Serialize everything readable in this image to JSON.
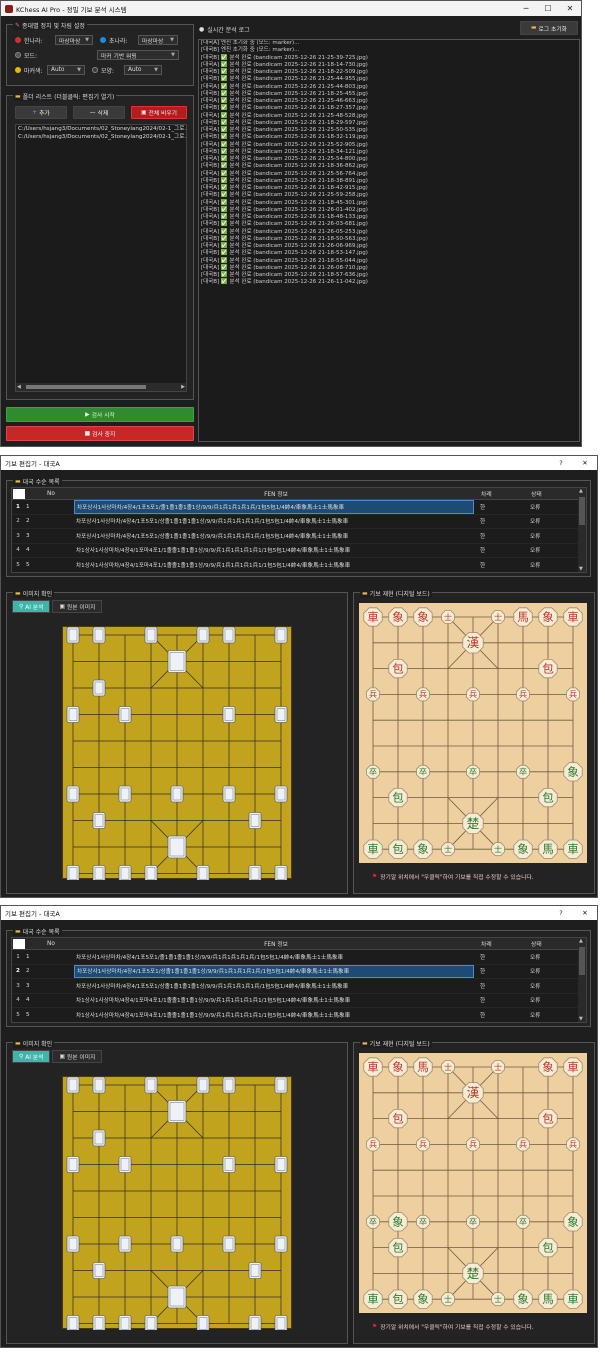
{
  "main_window": {
    "title": "KChess AI Pro - 정밀 기보 분석 시스템",
    "settings_group": "종대별 정치 및 차림 설정",
    "han_label": "한나라:",
    "han_value": "마상마상",
    "cho_label": "초나라:",
    "cho_value": "마상마상",
    "mode_label": "모드:",
    "mode_value": "마커 기반 워핑",
    "marker_label": "마커색:",
    "marker_value": "Auto",
    "shape_label": "모양:",
    "shape_value": "Auto",
    "folder_group": "폴더 리스트 (더블클릭: 편집기 열기)",
    "add_btn": "추가",
    "delete_btn": "삭제",
    "clear_btn": "전체 비우기",
    "folders": [
      "C:/Users/hsjang3/Documents/02_Stoneylang2024/02-1_그로.",
      "C:/Users/hsjang3/Documents/02_Stoneylang2024/02-1_그로."
    ],
    "start_btn": "검사 시작",
    "stop_btn": "검사 중지",
    "log_group": "실시간 분석 로그",
    "log_reset_btn": "로그 초기화",
    "log_init_lines": [
      "[대국A]  엔진 초기화 중 (모드: marker)...",
      "[대국B]  엔진 초기화 중 (모드: marker)..."
    ],
    "log_lines": [
      "[대국B] ✅ 분석 완료 (bandicam 2025-12-26 21-25-39-725.jpg)",
      "[대국A] ✅ 분석 완료 (bandicam 2025-12-26 21-18-14-730.jpg)",
      "[대국B] ✅ 분석 완료 (bandicam 2025-12-26 21-18-22-509.jpg)",
      "[대국B] ✅ 분석 완료 (bandicam 2025-12-26 21-25-44-955.jpg)",
      "[대국A] ✅ 분석 완료 (bandicam 2025-12-26 21-25-44-803.jpg)",
      "[대국B] ✅ 분석 완료 (bandicam 2025-12-26 21-18-25-455.jpg)",
      "[대국A] ✅ 분석 완료 (bandicam 2025-12-26 21-25-46-663.jpg)",
      "[대국B] ✅ 분석 완료 (bandicam 2025-12-26 21-18-27-357.jpg)",
      "[대국A] ✅ 분석 완료 (bandicam 2025-12-26 21-25-48-528.jpg)",
      "[대국B] ✅ 분석 완료 (bandicam 2025-12-26 21-18-29-597.jpg)",
      "[대국A] ✅ 분석 완료 (bandicam 2025-12-26 21-25-50-535.jpg)",
      "[대국B] ✅ 분석 완료 (bandicam 2025-12-26 21-18-32-119.jpg)",
      "[대국A] ✅ 분석 완료 (bandicam 2025-12-26 21-25-52-905.jpg)",
      "[대국B] ✅ 분석 완료 (bandicam 2025-12-26 21-18-34-121.jpg)",
      "[대국A] ✅ 분석 완료 (bandicam 2025-12-26 21-25-54-800.jpg)",
      "[대국B] ✅ 분석 완료 (bandicam 2025-12-26 21-18-36-862.jpg)",
      "[대국A] ✅ 분석 완료 (bandicam 2025-12-26 21-25-56-764.jpg)",
      "[대국B] ✅ 분석 완료 (bandicam 2025-12-26 21-18-38-891.jpg)",
      "[대국A] ✅ 분석 완료 (bandicam 2025-12-26 21-18-42-915.jpg)",
      "[대국B] ✅ 분석 완료 (bandicam 2025-12-26 21-25-59-258.jpg)",
      "[대국A] ✅ 분석 완료 (bandicam 2025-12-26 21-18-45-301.jpg)",
      "[대국B] ✅ 분석 완료 (bandicam 2025-12-26 21-26-01-402.jpg)",
      "[대국A] ✅ 분석 완료 (bandicam 2025-12-26 21-18-48-133.jpg)",
      "[대국B] ✅ 분석 완료 (bandicam 2025-12-26 21-26-03-681.jpg)",
      "[대국A] ✅ 분석 완료 (bandicam 2025-12-26 21-26-05-253.jpg)",
      "[대국B] ✅ 분석 완료 (bandicam 2025-12-26 21-18-50-563.jpg)",
      "[대국A] ✅ 분석 완료 (bandicam 2025-12-26 21-26-06-969.jpg)",
      "[대국B] ✅ 분석 완료 (bandicam 2025-12-26 21-18-53-147.jpg)",
      "[대국A] ✅ 분석 완료 (bandicam 2025-12-26 21-18-55-044.jpg)",
      "[대국A] ✅ 분석 완료 (bandicam 2025-12-26 21-26-08-710.jpg)",
      "[대국B] ✅ 분석 완료 (bandicam 2025-12-26 21-18-57-636.jpg)",
      "[대국B] ✅ 분석 완료 (bandicam 2025-12-26 21-26-11-042.jpg)"
    ]
  },
  "editor": {
    "title": "기보 편집기 - 대국A",
    "help": "?",
    "close": "✕",
    "moves_group": "대국 수순 목록",
    "col_no": "No",
    "col_fen": "FEN 정보",
    "col_turn": "차례",
    "col_state": "상태",
    "rows": [
      {
        "idx": "1",
        "no": "1",
        "fen": "차포상사1사상마차/4장4/1포5포1/졸1졸1졸1졸1상/9/9/兵1兵1兵1兵1兵/1包5包1/4帥4/車象馬士1士馬象車",
        "turn": "한",
        "state": "오류"
      },
      {
        "idx": "2",
        "no": "2",
        "fen": "차포상사1사상마차/4장4/1포5포1/상졸1졸1졸1졸1상/9/9/兵1兵1兵1兵1兵/1包5包1/4帥4/車象馬士1士馬象車",
        "turn": "한",
        "state": "오류"
      },
      {
        "idx": "3",
        "no": "3",
        "fen": "차포상사1사상마차/4장4/1포5포1/상졸1졸1졸1졸1상/9/9/兵1兵1兵1兵1兵/1包5包1/4帥4/車象馬士1士馬象車",
        "turn": "한",
        "state": "오류"
      },
      {
        "idx": "4",
        "no": "4",
        "fen": "차1상사1사상마차/4장4/1포마4포1/1졸졸1졸1졸1상/9/9/兵1兵1兵1兵1兵1/1包5包1/4帥4/車象馬士1士馬象車",
        "turn": "한",
        "state": "오류"
      },
      {
        "idx": "5",
        "no": "5",
        "fen": "차1상사1사상마차/4장4/1포마4포1/1졸졸1졸1졸1상/9/9/兵1兵1兵1兵1兵1/1包5包1/4帥4/車象馬士1士馬象車",
        "turn": "한",
        "state": "오류"
      }
    ],
    "image_group": "이미지 확인",
    "tab_ai": "AI 분석",
    "tab_orig": "원본 이미지",
    "board_group": "기보 재현 (디지털 보드)",
    "hint": "장기알 위치에서 \"우클릭\"하여 기보를 직접 수정할 수 있습니다.",
    "board1": {
      "top": [
        "車",
        "象",
        "象",
        "士",
        "",
        "士",
        "馬",
        "象",
        "車"
      ],
      "row2_center": "漢",
      "cannons_top": [
        "包",
        "包"
      ],
      "soldiers_top": [
        "兵",
        "兵",
        "兵",
        "兵",
        "兵"
      ],
      "soldiers_bottom": [
        "卒",
        "卒",
        "卒",
        "卒",
        "卒"
      ],
      "cannons_bottom": [
        "包",
        "包"
      ],
      "king_bottom": "楚",
      "bottom": [
        "車",
        "包",
        "象",
        "士",
        "",
        "士",
        "象",
        "馬",
        "車"
      ],
      "extra_right": "象"
    },
    "board2": {
      "top": [
        "車",
        "象",
        "馬",
        "士",
        "",
        "士",
        "",
        "象",
        "車"
      ],
      "row2_center": "漢",
      "cannons_top": [
        "包",
        "包"
      ],
      "soldiers_top": [
        "兵",
        "兵",
        "兵",
        "兵",
        "兵"
      ],
      "soldiers_bottom": [
        "卒",
        "卒",
        "卒",
        "卒",
        "卒"
      ],
      "cannons_bottom": [
        "包",
        "包"
      ],
      "elephants_mid": [
        "象",
        "象"
      ],
      "king_bottom": "楚",
      "bottom": [
        "車",
        "包",
        "象",
        "士",
        "",
        "士",
        "象",
        "馬",
        "車"
      ]
    }
  },
  "colors": {
    "accent_teal": "#3fb4a8",
    "start_green": "#2e8b2e",
    "stop_red": "#c62828",
    "clear_red": "#b71c1c",
    "piece_red": "#c0392b",
    "piece_green": "#2e7d32",
    "board": "#eed0a0"
  }
}
